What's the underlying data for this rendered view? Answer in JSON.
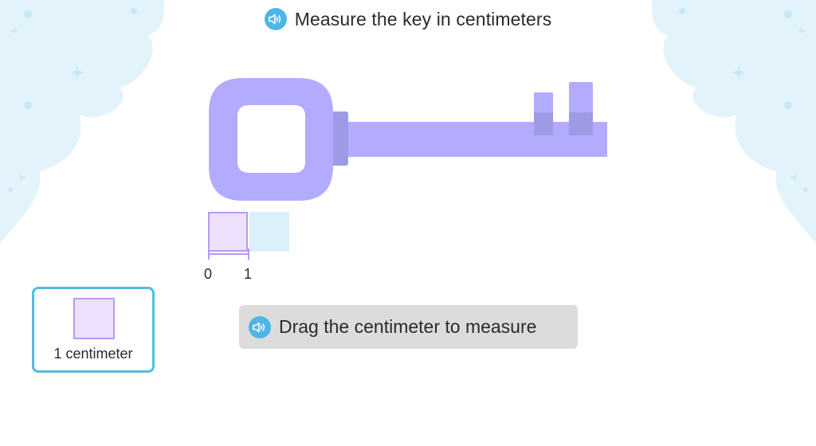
{
  "title": {
    "text": "Measure the key in centimeters",
    "audio_icon": "speaker-icon"
  },
  "ruler": {
    "tick_labels": [
      "0",
      "1"
    ],
    "units_placed": 1,
    "next_slot_hint": "ghost-unit"
  },
  "palette": {
    "label": "1 centimeter",
    "item_icon": "centimeter-square"
  },
  "hint": {
    "text": "Drag the centimeter to measure",
    "audio_icon": "speaker-icon"
  },
  "colors": {
    "key": "#b3abfe",
    "key_shade": "#9f9ae6",
    "unit_fill": "#ece0fd",
    "unit_border": "#b89af0",
    "ghost_fill": "#dcf0fb",
    "accent": "#4fb5e6",
    "palette_border": "#4fbde0",
    "hint_bg": "#dcdcdc",
    "cloud": "#e2f3fb"
  }
}
